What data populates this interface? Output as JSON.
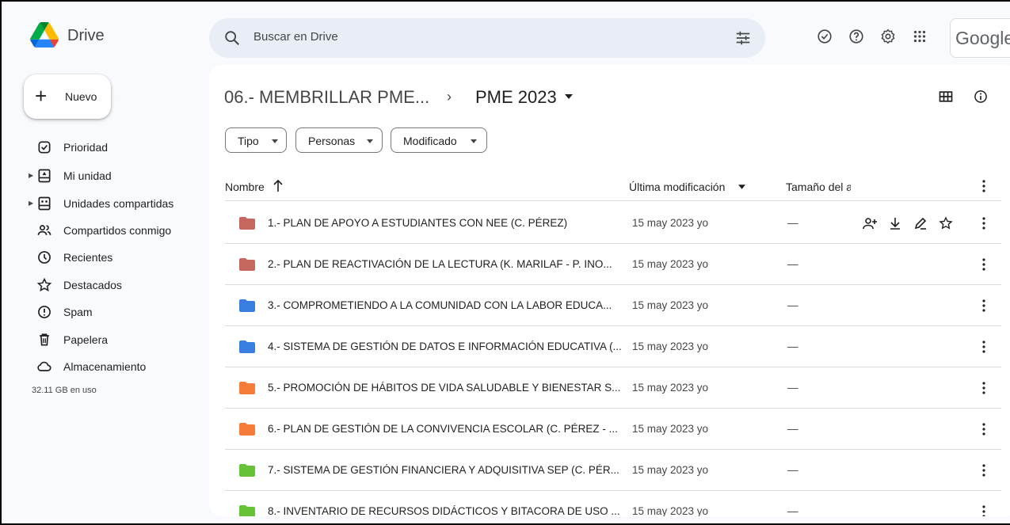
{
  "app": {
    "name": "Drive",
    "google_label": "Google"
  },
  "search": {
    "placeholder": "Buscar en Drive"
  },
  "sidebar": {
    "new_label": "Nuevo",
    "items": [
      {
        "label": "Prioridad",
        "icon": "priority-icon",
        "expandable": false
      },
      {
        "label": "Mi unidad",
        "icon": "my-drive-icon",
        "expandable": true
      },
      {
        "label": "Unidades compartidas",
        "icon": "shared-drives-icon",
        "expandable": true
      },
      {
        "label": "Compartidos conmigo",
        "icon": "people-icon",
        "expandable": false
      },
      {
        "label": "Recientes",
        "icon": "clock-icon",
        "expandable": false
      },
      {
        "label": "Destacados",
        "icon": "star-icon",
        "expandable": false
      },
      {
        "label": "Spam",
        "icon": "spam-icon",
        "expandable": false
      },
      {
        "label": "Papelera",
        "icon": "trash-icon",
        "expandable": false
      },
      {
        "label": "Almacenamiento",
        "icon": "cloud-icon",
        "expandable": false
      }
    ],
    "storage_text": "32.11 GB en uso"
  },
  "breadcrumb": {
    "parent": "06.- MEMBRILLAR PME...",
    "separator": "›",
    "current": "PME 2023"
  },
  "filters": [
    {
      "label": "Tipo"
    },
    {
      "label": "Personas"
    },
    {
      "label": "Modificado"
    }
  ],
  "table": {
    "headers": {
      "name": "Nombre",
      "modified": "Última modificación",
      "size": "Tamaño del a"
    },
    "rows": [
      {
        "name": "1.- PLAN DE APOYO A ESTUDIANTES CON NEE (C. PÉREZ)",
        "modified": "15 may 2023 yo",
        "size": "—",
        "color": "#c5675f",
        "hovered": true
      },
      {
        "name": "2.- PLAN DE REACTIVACIÓN DE LA LECTURA  (K. MARILAF - P. INO...",
        "modified": "15 may 2023 yo",
        "size": "—",
        "color": "#c5675f",
        "hovered": false
      },
      {
        "name": "3.- COMPROMETIENDO A LA COMUNIDAD CON LA LABOR EDUCA...",
        "modified": "15 may 2023 yo",
        "size": "—",
        "color": "#3a7ee0",
        "hovered": false
      },
      {
        "name": "4.- SISTEMA DE GESTIÓN DE DATOS E INFORMACIÓN EDUCATIVA (...",
        "modified": "15 may 2023 yo",
        "size": "—",
        "color": "#3a7ee0",
        "hovered": false
      },
      {
        "name": "5.- PROMOCIÓN DE HÁBITOS DE VIDA SALUDABLE Y BIENESTAR S...",
        "modified": "15 may 2023 yo",
        "size": "—",
        "color": "#f57c3a",
        "hovered": false
      },
      {
        "name": "6.- PLAN DE GESTIÓN DE LA CONVIVENCIA ESCOLAR (C. PÉREZ - ...",
        "modified": "15 may 2023 yo",
        "size": "—",
        "color": "#f57c3a",
        "hovered": false
      },
      {
        "name": "7.- SISTEMA DE GESTIÓN FINANCIERA Y ADQUISITIVA SEP (C. PÉR...",
        "modified": "15 may 2023 yo",
        "size": "—",
        "color": "#67c23a",
        "hovered": false
      },
      {
        "name": "8.- INVENTARIO DE RECURSOS DIDÁCTICOS Y BITACORA DE USO ...",
        "modified": "15 may 2023 yo",
        "size": "—",
        "color": "#67c23a",
        "hovered": false
      }
    ]
  },
  "colors": {
    "accent": "#0b57d0",
    "panel_bg": "#f8fafd",
    "search_bg": "#e9eef6"
  }
}
